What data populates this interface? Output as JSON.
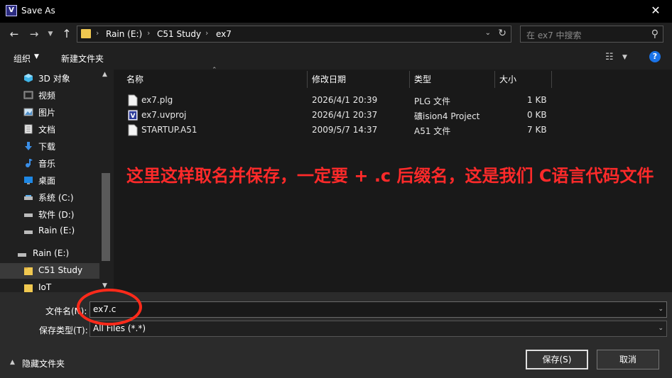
{
  "window": {
    "title": "Save As",
    "app_icon": "V"
  },
  "nav": {
    "back_glyph": "←",
    "forward_glyph": "→",
    "recent_glyph": "⌄",
    "up_glyph": "🡑"
  },
  "address": {
    "crumbs": [
      "Rain (E:)",
      "C51 Study",
      "ex7"
    ]
  },
  "search": {
    "placeholder": "在 ex7 中搜索"
  },
  "toolbar": {
    "organize": "组织",
    "new_folder": "新建文件夹"
  },
  "nav_pane": {
    "items": [
      {
        "label": "3D 对象",
        "icon": "3d-objects-icon"
      },
      {
        "label": "视频",
        "icon": "video-icon"
      },
      {
        "label": "图片",
        "icon": "pictures-icon"
      },
      {
        "label": "文档",
        "icon": "documents-icon"
      },
      {
        "label": "下载",
        "icon": "download-icon"
      },
      {
        "label": "音乐",
        "icon": "music-icon"
      },
      {
        "label": "桌面",
        "icon": "desktop-icon"
      },
      {
        "label": "系统 (C:)",
        "icon": "drive-icon"
      },
      {
        "label": "软件 (D:)",
        "icon": "drive-icon"
      },
      {
        "label": "Rain (E:)",
        "icon": "drive-icon"
      },
      {
        "label": "Rain (E:)",
        "icon": "drive-icon"
      },
      {
        "label": "C51 Study",
        "icon": "folder-icon",
        "selected": true
      },
      {
        "label": "IoT",
        "icon": "folder-icon"
      }
    ]
  },
  "file_list": {
    "columns": {
      "name": "名称",
      "modified": "修改日期",
      "type": "类型",
      "size": "大小"
    },
    "rows": [
      {
        "name": "ex7.plg",
        "modified": "2026/4/1 20:39",
        "type": "PLG 文件",
        "size": "1 KB",
        "icon": "file-icon"
      },
      {
        "name": "ex7.uvproj",
        "modified": "2026/4/1 20:37",
        "type": "礦ision4 Project",
        "size": "0 KB",
        "icon": "uvision-icon"
      },
      {
        "name": "STARTUP.A51",
        "modified": "2009/5/7 14:37",
        "type": "A51 文件",
        "size": "7 KB",
        "icon": "file-icon"
      }
    ]
  },
  "annotation": {
    "text": "这里这样取名并保存，一定要 + .c 后缀名，这是我们 C语言代码文件",
    "color": "#ff2a2a"
  },
  "form": {
    "filename_label": "文件名(N):",
    "filename_value": "ex7.c",
    "filetype_label": "保存类型(T):",
    "filetype_value": "All Files (*.*)"
  },
  "footer": {
    "hide_folders": "隐藏文件夹",
    "save": "保存(S)",
    "cancel": "取消"
  }
}
